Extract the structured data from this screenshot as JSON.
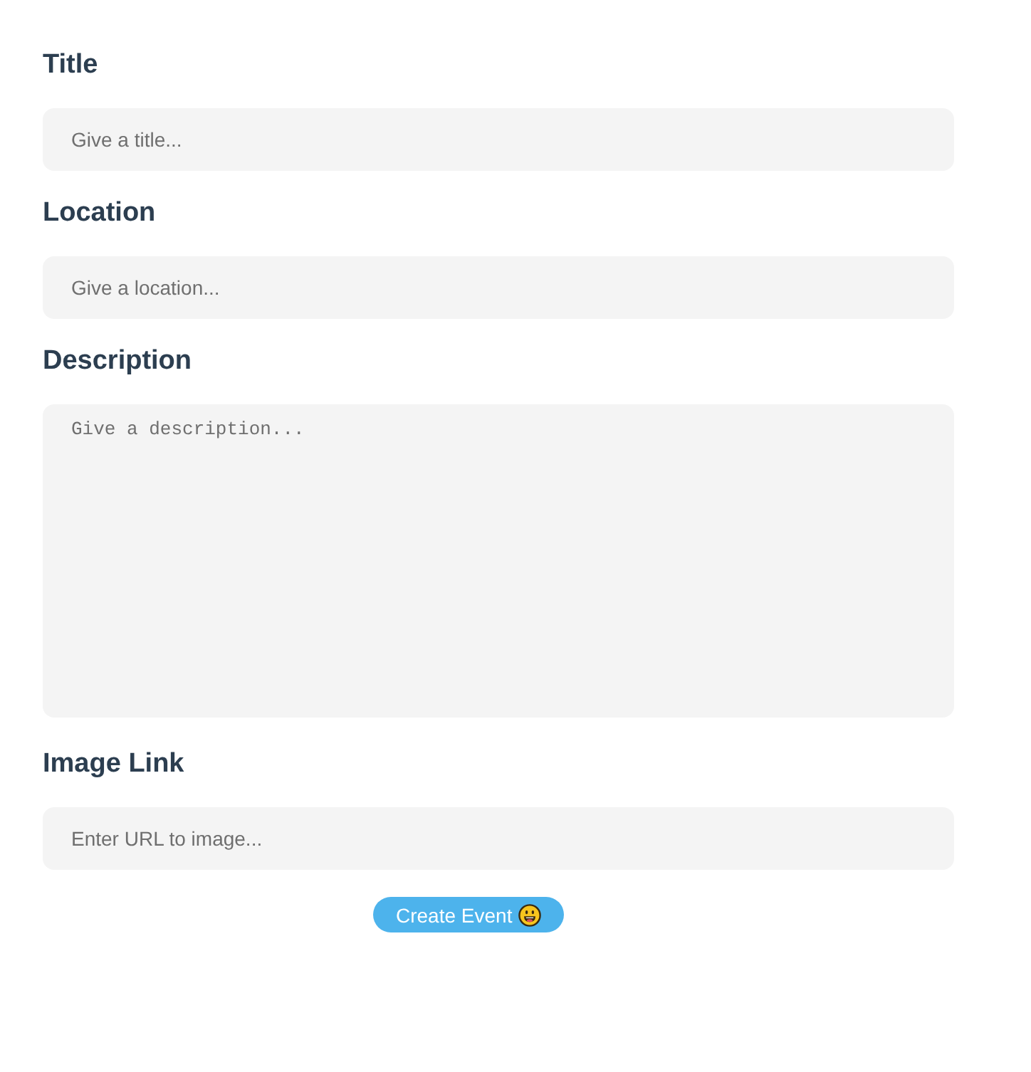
{
  "fields": [
    {
      "label": "Title",
      "kind": "input",
      "placeholder": "Give a title..."
    },
    {
      "label": "Location",
      "kind": "input",
      "placeholder": "Give a location..."
    },
    {
      "label": "Description",
      "kind": "textarea",
      "placeholder": "Give a description..."
    },
    {
      "label": "Image Link",
      "kind": "input",
      "placeholder": "Enter URL to image..."
    }
  ],
  "submit_button": {
    "label": "Create Event"
  }
}
